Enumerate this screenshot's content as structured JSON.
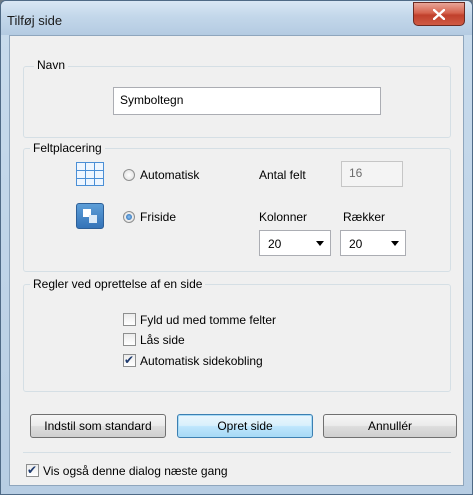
{
  "window": {
    "title": "Tilføj side"
  },
  "name_group": {
    "legend": "Navn",
    "value": "Symboltegn"
  },
  "placement": {
    "legend": "Feltplacering",
    "auto_label": "Automatisk",
    "auto_checked": false,
    "count_label": "Antal felt",
    "count_value": "16",
    "free_label": "Friside",
    "free_checked": true,
    "columns_label": "Kolonner",
    "columns_value": "20",
    "rows_label": "Rækker",
    "rows_value": "20"
  },
  "rules": {
    "legend": "Regler ved oprettelse af en side",
    "options": [
      {
        "label": "Fyld ud med tomme felter",
        "checked": false
      },
      {
        "label": "Lås side",
        "checked": false
      },
      {
        "label": "Automatisk sidekobling",
        "checked": true
      }
    ]
  },
  "buttons": {
    "set_default": "Indstil som standard",
    "create": "Opret side",
    "cancel": "Annullér"
  },
  "footer": {
    "show_again_label": "Vis også denne dialog næste gang",
    "show_again_checked": true
  },
  "icons": {
    "close": "close-icon",
    "auto_layout": "grid-icon",
    "free_layout": "free-layout-icon",
    "dropdown": "chevron-down-icon",
    "checkmark": "checkmark-icon"
  },
  "colors": {
    "close_button": "#c8432e",
    "default_button_border": "#3c7fb1",
    "titlebar": "#c3d7ea"
  }
}
